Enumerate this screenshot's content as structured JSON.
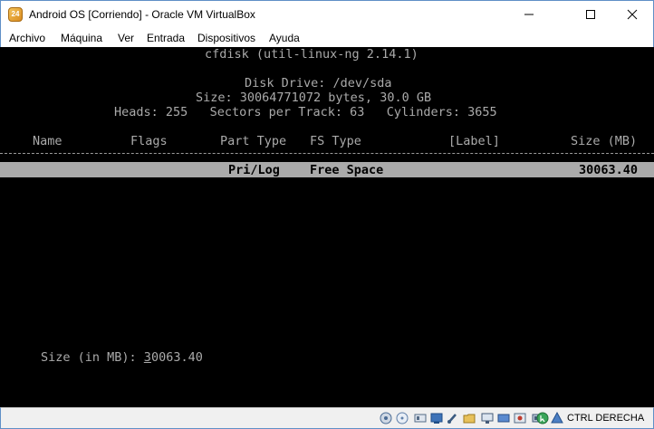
{
  "window": {
    "title": "Android OS [Corriendo] - Oracle VM VirtualBox",
    "app_icon_text": "24"
  },
  "menu": [
    "Archivo",
    "Máquina",
    "Ver",
    "Entrada",
    "Dispositivos",
    "Ayuda"
  ],
  "terminal": {
    "program": "cfdisk (util-linux-ng 2.14.1)",
    "disk_drive": "Disk Drive: /dev/sda",
    "size": "Size: 30064771072 bytes, 30.0 GB",
    "geometry": "Heads: 255   Sectors per Track: 63   Cylinders: 3655",
    "headers": {
      "name": "Name",
      "flags": "Flags",
      "part_type": "Part Type",
      "fs_type": "FS Type",
      "label": "[Label]",
      "size": "Size (MB)"
    },
    "row": {
      "part_type": "Pri/Log",
      "fs_type": "Free Space",
      "size": "30063.40"
    },
    "prompt_label": "Size (in MB): ",
    "prompt_value_first": "3",
    "prompt_value_rest": "0063.40"
  },
  "statusbar": {
    "host_key": "CTRL DERECHA",
    "icons": [
      "hard-disk-icon",
      "optical-drive-icon",
      "audio-icon",
      "network-icon",
      "usb-icon",
      "shared-folders-icon",
      "display-icon",
      "video-capture-icon",
      "recording-icon",
      "cpu-icon",
      "mouse-integration-icon",
      "keyboard-icon"
    ]
  },
  "colors": {
    "terminal_bg": "#000000",
    "terminal_fg": "#aaaaaa",
    "highlight_bg": "#aaaaaa",
    "window_border": "#5f8fc7"
  }
}
